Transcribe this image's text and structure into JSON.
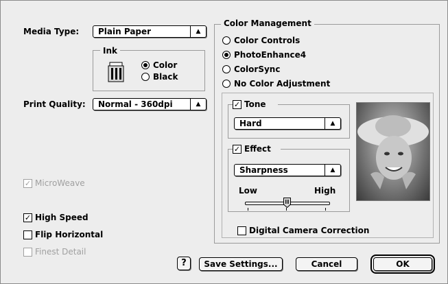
{
  "left": {
    "media_type_label": "Media Type:",
    "media_type_value": "Plain Paper",
    "ink_group_title": "Ink",
    "ink_options": [
      "Color",
      "Black"
    ],
    "ink_selected": "Color",
    "print_quality_label": "Print Quality:",
    "print_quality_value": "Normal - 360dpi",
    "microweave_label": "MicroWeave",
    "high_speed_label": "High Speed",
    "flip_horizontal_label": "Flip Horizontal",
    "finest_detail_label": "Finest Detail"
  },
  "color_management": {
    "title": "Color Management",
    "options": [
      "Color Controls",
      "PhotoEnhance4",
      "ColorSync",
      "No Color Adjustment"
    ],
    "selected": "PhotoEnhance4",
    "tone_label": "Tone",
    "tone_value": "Hard",
    "effect_label": "Effect",
    "effect_value": "Sharpness",
    "slider_low": "Low",
    "slider_high": "High",
    "slider_level_percent": 50,
    "digital_camera_label": "Digital Camera Correction"
  },
  "buttons": {
    "help": "?",
    "save_settings": "Save Settings...",
    "cancel": "Cancel",
    "ok": "OK"
  },
  "icons": [
    "ink-bottle-icon",
    "help-icon",
    "popup-arrow-icon"
  ],
  "colors": {
    "dialog_bg": "#ededed",
    "border": "#000000",
    "disabled_text": "#a0a0a0"
  }
}
